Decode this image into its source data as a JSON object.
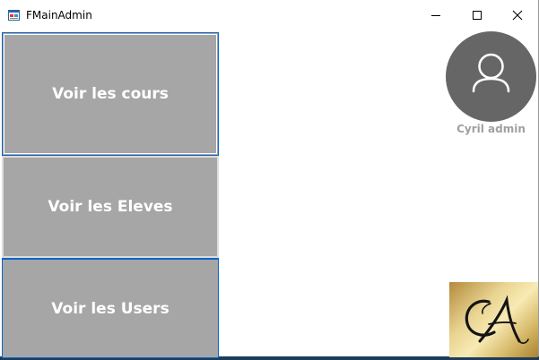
{
  "window": {
    "title": "FMainAdmin"
  },
  "menu_buttons": {
    "cours": "Voir les cours",
    "eleves": "Voir les Eleves",
    "users": "Voir les Users"
  },
  "user": {
    "name": "Cyril admin"
  },
  "logo": {
    "initials": "CA"
  },
  "icons": {
    "app": "form-app-icon",
    "minimize": "minimize-icon",
    "maximize": "maximize-icon",
    "close": "close-icon",
    "avatar": "user-avatar-icon",
    "logo": "ca-monogram-logo"
  },
  "colors": {
    "button_bg": "#a6a6a6",
    "button_text": "#ffffff",
    "focus_border": "#0a64c8",
    "avatar_bg": "#666666",
    "username_text": "#a0a0a0"
  }
}
